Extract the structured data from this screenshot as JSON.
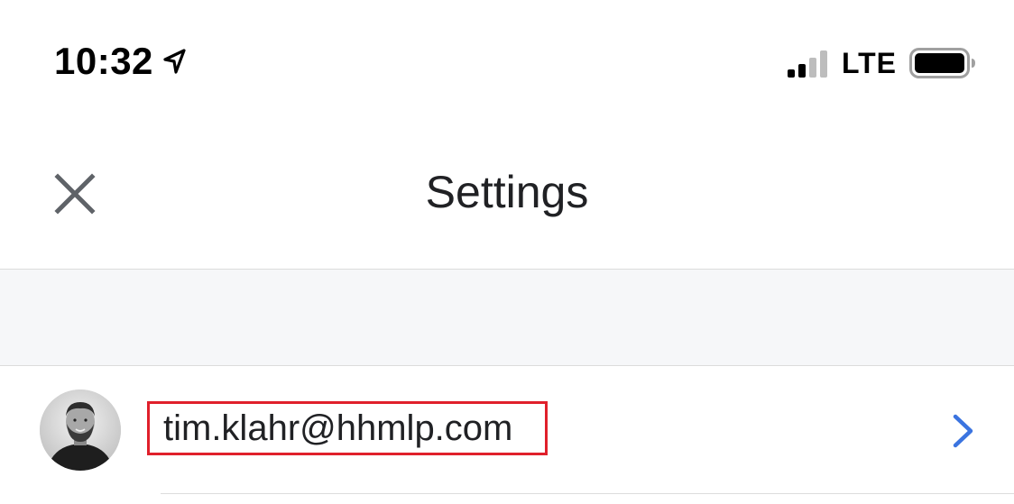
{
  "status_bar": {
    "time": "10:32",
    "network": "LTE",
    "icons": [
      "location-arrow-icon",
      "cellular-signal-icon",
      "battery-icon"
    ]
  },
  "header": {
    "title": "Settings",
    "close_icon": "close-icon"
  },
  "account": {
    "email": "tim.klahr@hhmlp.com",
    "avatar": "profile-photo",
    "chevron_icon": "chevron-right-icon",
    "highlight_color": "#e0202b"
  },
  "colors": {
    "accent": "#3b74e0",
    "title_text": "#202124",
    "section_background": "#f6f7f9",
    "divider": "#dcdcdc"
  }
}
